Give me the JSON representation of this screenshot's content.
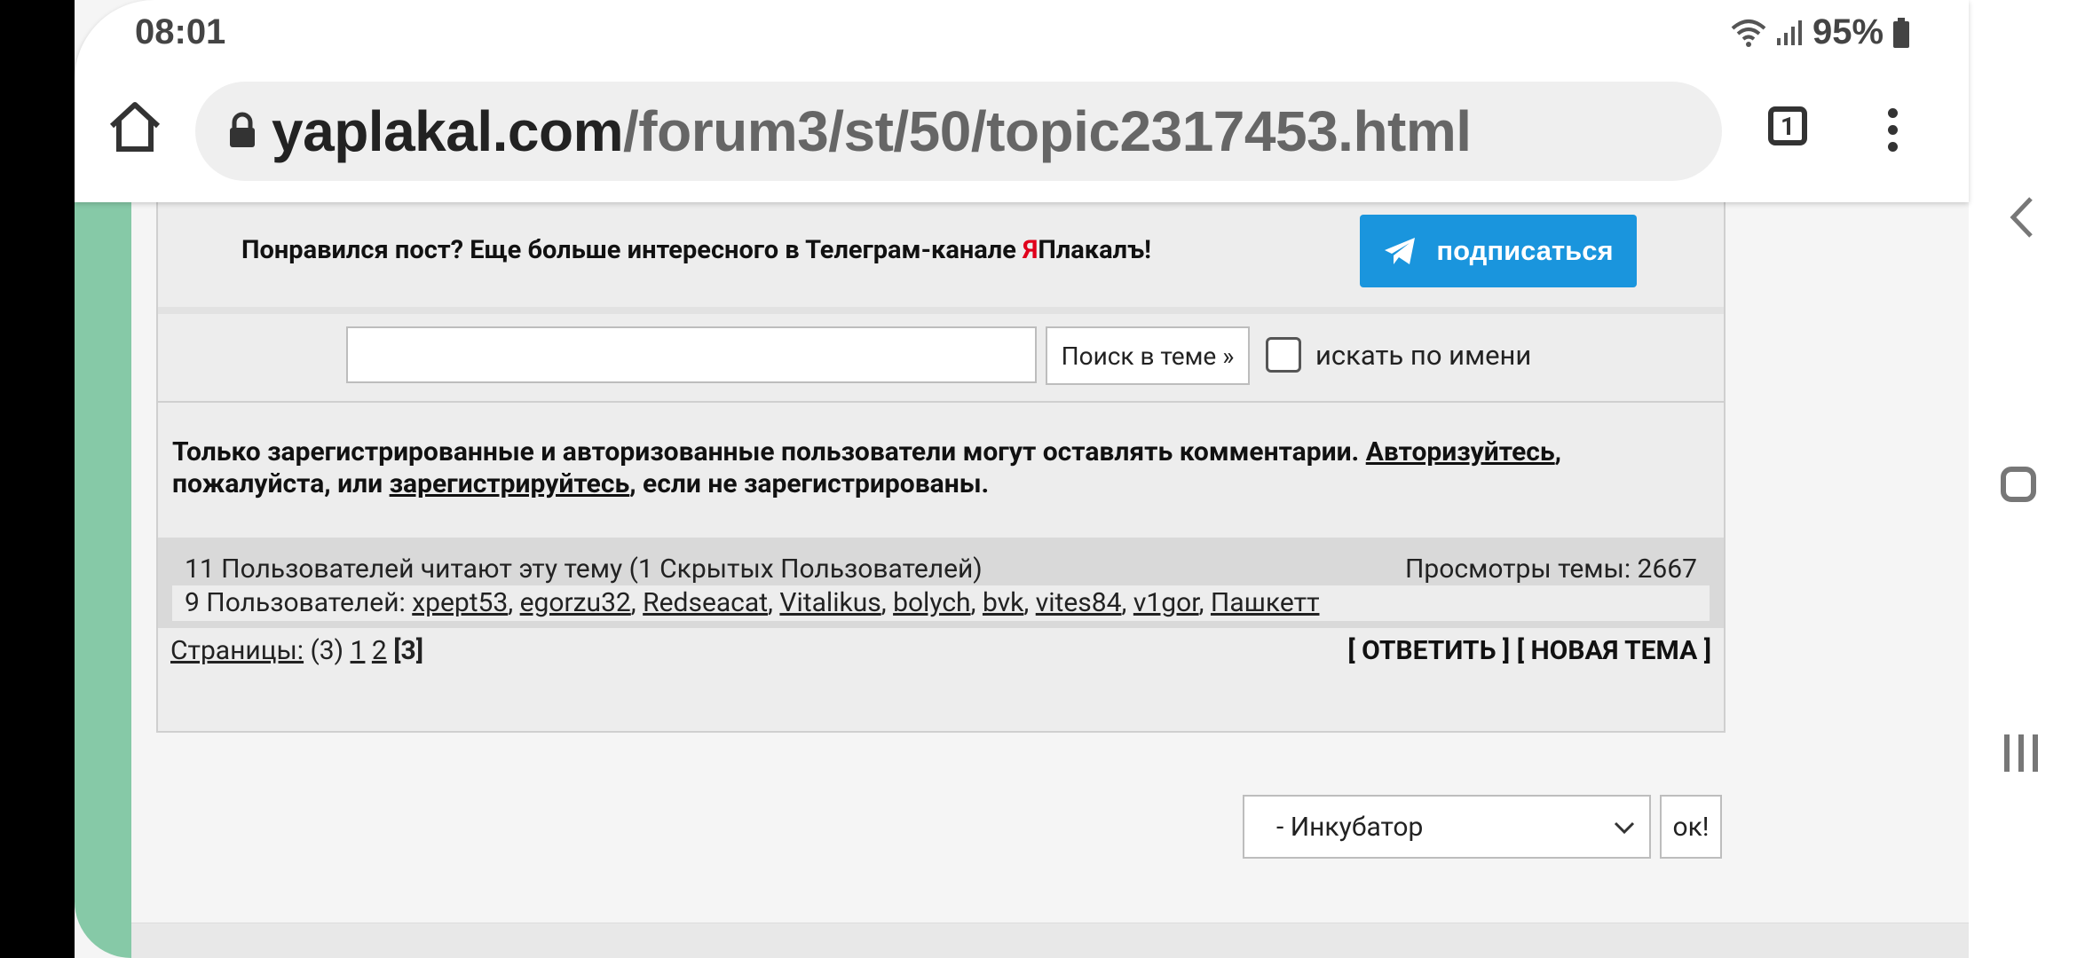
{
  "status": {
    "time": "08:01",
    "battery": "95%"
  },
  "browser": {
    "url_host": "yaplakal.com",
    "url_path": "/forum3/st/50/topic2317453.html",
    "tabs_count": "1"
  },
  "promo": {
    "text_before": "Понравился пост? Еще больше интересного в Телеграм-канале ",
    "brand_red": "Я",
    "brand_rest": "Плакалъ!",
    "subscribe_label": "подписаться"
  },
  "search": {
    "button_label": "Поиск в теме »",
    "checkbox_label": "искать по имени"
  },
  "notice": {
    "text1": "Только зарегистрированные и авторизованные пользователи могут оставлять комментарии. ",
    "login_link": "Авторизуйтесь",
    "text2": ", пожалуйста, или ",
    "register_link": "зарегистрируйтесь",
    "text3": ", если не зарегистрированы."
  },
  "readers": {
    "summary": "11 Пользователей читают эту тему (1 Скрытых Пользователей)",
    "views": "Просмотры темы: 2667",
    "users_prefix": "9 Пользователей: ",
    "users": [
      "xpept53",
      "egorzu32",
      "Redseacat",
      "Vitalikus",
      "bolych",
      "bvk",
      "vites84",
      "v1gor",
      "Пашкетт"
    ]
  },
  "pager": {
    "label": "Страницы:",
    "total": " (3) ",
    "page1": "1",
    "page2": "2",
    "current": "[3]"
  },
  "actions": {
    "reply": "[ ОТВЕТИТЬ ]",
    "new_topic": "[ НОВАЯ ТЕМА ]"
  },
  "forum_jump": {
    "selected": "- Инкубатор",
    "ok_label": "ок!"
  }
}
